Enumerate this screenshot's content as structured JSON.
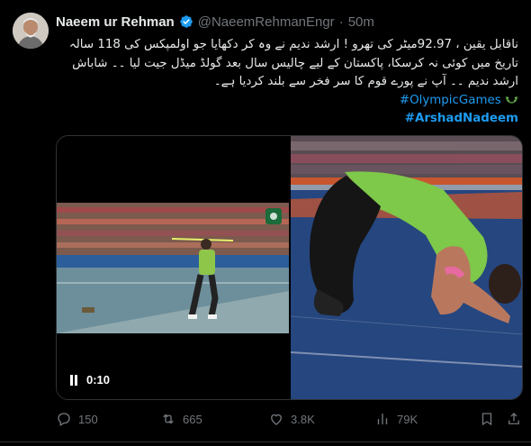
{
  "tweet": {
    "author_name": "Naeem ur Rehman",
    "handle": "@NaeemRehmanEngr",
    "dot": "·",
    "time": "50m",
    "text_line_1": "ناقابل یقین ، 92.97میٹر کی تھرو ! ارشد ندیم نے وہ کر دکھایا جو اولمپکس کی 118 سالہ",
    "text_line_2": "تاریخ میں کوئی نہ کرسکا، پاکستان کے لیے چالیس سال بعد گولڈ میڈل جیت لیا ۔۔ شاباش",
    "text_line_3": "ارشد ندیم ۔۔ آپ نے پورے قوم کا سر فخر سے بلند کردیا ہے۔",
    "hashtag_1": "#OlympicGames",
    "hashtag_2": "#ArshadNadeem"
  },
  "media": {
    "video_time": "0:10"
  },
  "actions": {
    "replies": "150",
    "reposts": "665",
    "likes": "3.8K",
    "views": "79K"
  },
  "colors": {
    "accent": "#1d9bf0",
    "muted": "#71767b",
    "text": "#e7e9ea",
    "background": "#000000"
  },
  "icons": [
    "verified-badge-icon",
    "olympic-wreath-icon",
    "pause-icon",
    "reply-icon",
    "repost-icon",
    "like-icon",
    "views-icon",
    "bookmark-icon",
    "share-icon"
  ]
}
